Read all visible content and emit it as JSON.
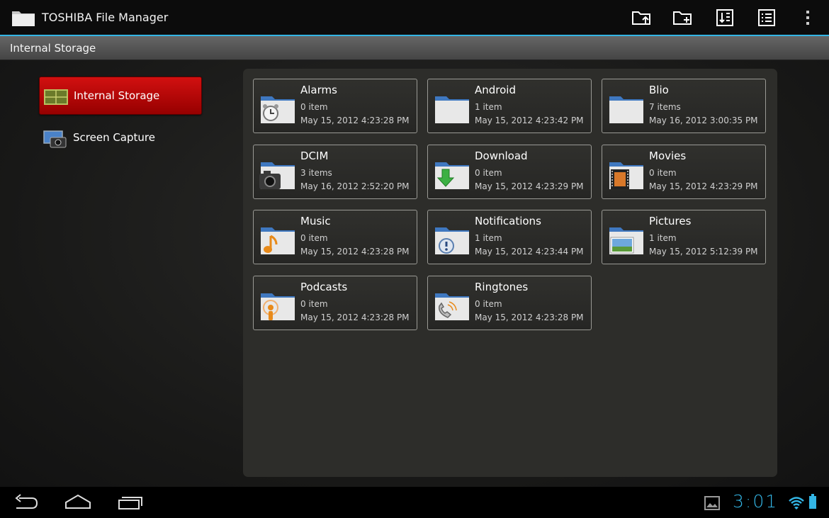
{
  "app": {
    "title": "TOSHIBA File Manager"
  },
  "toolbar": {
    "upload_icon": "folder-upload-icon",
    "new_folder_icon": "folder-add-icon",
    "sort_icon": "sort-icon",
    "list_view_icon": "list-view-icon",
    "overflow_icon": "overflow-menu-icon"
  },
  "path": {
    "current": "Internal Storage"
  },
  "sidebar": {
    "items": [
      {
        "label": "Internal Storage",
        "icon": "storage-icon",
        "selected": true
      },
      {
        "label": "Screen Capture",
        "icon": "screen-capture-icon",
        "selected": false
      }
    ]
  },
  "folders": [
    {
      "name": "Alarms",
      "count": "0 item",
      "date": "May 15, 2012 4:23:28 PM",
      "icon": "alarm-folder-icon"
    },
    {
      "name": "Android",
      "count": "1 item",
      "date": "May 15, 2012 4:23:42 PM",
      "icon": "folder-icon"
    },
    {
      "name": "Blio",
      "count": "7 items",
      "date": "May 16, 2012 3:00:35 PM",
      "icon": "folder-icon"
    },
    {
      "name": "DCIM",
      "count": "3 items",
      "date": "May 16, 2012 2:52:20 PM",
      "icon": "camera-folder-icon"
    },
    {
      "name": "Download",
      "count": "0 item",
      "date": "May 15, 2012 4:23:29 PM",
      "icon": "download-folder-icon"
    },
    {
      "name": "Movies",
      "count": "0 item",
      "date": "May 15, 2012 4:23:29 PM",
      "icon": "movies-folder-icon"
    },
    {
      "name": "Music",
      "count": "0 item",
      "date": "May 15, 2012 4:23:28 PM",
      "icon": "music-folder-icon"
    },
    {
      "name": "Notifications",
      "count": "1 item",
      "date": "May 15, 2012 4:23:44 PM",
      "icon": "notifications-folder-icon"
    },
    {
      "name": "Pictures",
      "count": "1 item",
      "date": "May 15, 2012 5:12:39 PM",
      "icon": "pictures-folder-icon"
    },
    {
      "name": "Podcasts",
      "count": "0 item",
      "date": "May 15, 2012 4:23:28 PM",
      "icon": "podcasts-folder-icon"
    },
    {
      "name": "Ringtones",
      "count": "0 item",
      "date": "May 15, 2012 4:23:28 PM",
      "icon": "ringtones-folder-icon"
    }
  ],
  "statusbar": {
    "time": "3:01"
  },
  "colors": {
    "accent": "#33b5e5",
    "selected": "#c00000"
  }
}
